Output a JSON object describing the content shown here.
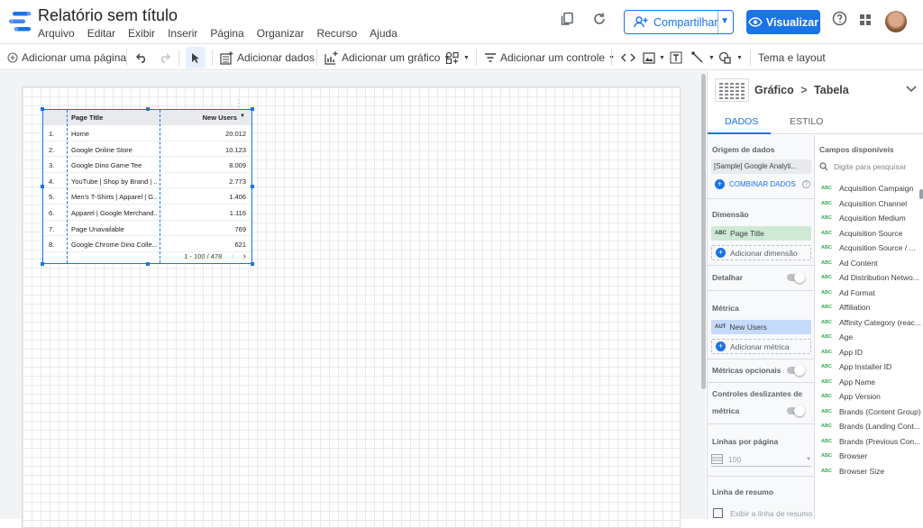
{
  "app": {
    "title": "Relatório sem título",
    "menus": [
      "Arquivo",
      "Editar",
      "Exibir",
      "Inserir",
      "Página",
      "Organizar",
      "Recurso",
      "Ajuda"
    ],
    "share_label": "Compartilhar",
    "view_label": "Visualizar"
  },
  "toolbar": {
    "add_page": "Adicionar uma página",
    "add_data": "Adicionar dados",
    "add_chart": "Adicionar um gráfico",
    "add_control": "Adicionar um controle",
    "theme": "Tema e layout"
  },
  "table": {
    "headers": [
      "Page Title",
      "New Users"
    ],
    "rows": [
      {
        "n": "1.",
        "title": "Home",
        "value": "20.012"
      },
      {
        "n": "2.",
        "title": "Google Online Store",
        "value": "10.123"
      },
      {
        "n": "3.",
        "title": "Google Dino Game Tee",
        "value": "8.009"
      },
      {
        "n": "4.",
        "title": "YouTube | Shop by Brand | ...",
        "value": "2.773"
      },
      {
        "n": "5.",
        "title": "Men's T-Shirts | Apparel | G...",
        "value": "1.406"
      },
      {
        "n": "6.",
        "title": "Apparel | Google Merchand...",
        "value": "1.116"
      },
      {
        "n": "7.",
        "title": "Page Unavailable",
        "value": "769"
      },
      {
        "n": "8.",
        "title": "Google Chrome Dino Colle...",
        "value": "621"
      }
    ],
    "pagination": "1 - 100 / 478"
  },
  "panel": {
    "crumb_a": "Gráfico",
    "crumb_sep": ">",
    "crumb_b": "Tabela",
    "tab_data": "DADOS",
    "tab_style": "ESTILO",
    "data_source_label": "Origem de dados",
    "data_source_value": "[Sample] Google Analyti...",
    "blend_label": "COMBINAR DADOS",
    "dimension_label": "Dimensão",
    "dimension_value": "Page Title",
    "dimension_tag": "ABC",
    "add_dimension": "Adicionar dimensão",
    "drill_label": "Detalhar",
    "metric_label": "Métrica",
    "metric_value": "New Users",
    "metric_tag": "AUT",
    "add_metric": "Adicionar métrica",
    "optional_metrics": "Métricas opcionais",
    "metric_sliders_1": "Controles deslizantes de",
    "metric_sliders_2": "métrica",
    "rows_per_page": "Linhas por página",
    "rows_per_page_value": "100",
    "summary_row": "Linha de resumo",
    "show_summary": "Exibir a linha de resumo",
    "available_fields": "Campos disponíveis",
    "search_placeholder": "Digite para pesquisar",
    "field_tag": "ABC",
    "fields": [
      "Acquisition Campaign",
      "Acquisition Channel",
      "Acquisition Medium",
      "Acquisition Source",
      "Acquisition Source / ...",
      "Ad Content",
      "Ad Distribution Netwo...",
      "Ad Format",
      "Affiliation",
      "Affinity Category (reac...",
      "Age",
      "App ID",
      "App Installer ID",
      "App Name",
      "App Version",
      "Brands (Content Group)",
      "Brands (Landing Cont...",
      "Brands (Previous Con...",
      "Browser",
      "Browser Size"
    ]
  },
  "colors": {
    "accent": "#1a73e8",
    "dimension_chip": "#ceead6",
    "metric_chip": "#c6dafc"
  }
}
